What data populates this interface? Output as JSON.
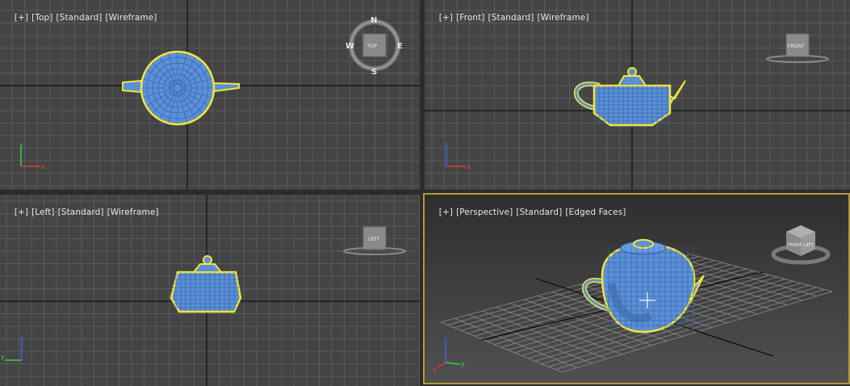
{
  "viewports": {
    "top": {
      "plus": "[+]",
      "view": "[Top]",
      "shading": "[Standard]",
      "mode": "[Wireframe]",
      "cube_face": "TOP",
      "compass": {
        "n": "N",
        "s": "S",
        "e": "E",
        "w": "W"
      },
      "axis_a": "y",
      "axis_b": "x"
    },
    "front": {
      "plus": "[+]",
      "view": "[Front]",
      "shading": "[Standard]",
      "mode": "[Wireframe]",
      "cube_face": "FRONT",
      "axis_a": "z",
      "axis_b": "x"
    },
    "left": {
      "plus": "[+]",
      "view": "[Left]",
      "shading": "[Standard]",
      "mode": "[Wireframe]",
      "cube_face": "LEFT",
      "axis_a": "z",
      "axis_b": "y"
    },
    "perspective": {
      "plus": "[+]",
      "view": "[Perspective]",
      "shading": "[Standard]",
      "mode": "[Edged Faces]",
      "cube_faces": {
        "front": "FRONT",
        "left": "LEFT"
      },
      "axis_a": "z",
      "axis_b": "y",
      "axis_c": "x",
      "active": true
    }
  },
  "colors": {
    "teapot_fill": "#5b8fd6",
    "wire": "#2f5fa8",
    "selection_outline": "#f2e63a",
    "active_border": "#b49a3a",
    "axis_x": "#e23b3b",
    "axis_y": "#3cd23c",
    "axis_z": "#3b66e8"
  },
  "icons": {
    "viewcube": "viewcube-icon",
    "compass": "compass-icon",
    "axis_tripod": "axis-tripod-icon",
    "cursor": "move-cursor-icon"
  }
}
